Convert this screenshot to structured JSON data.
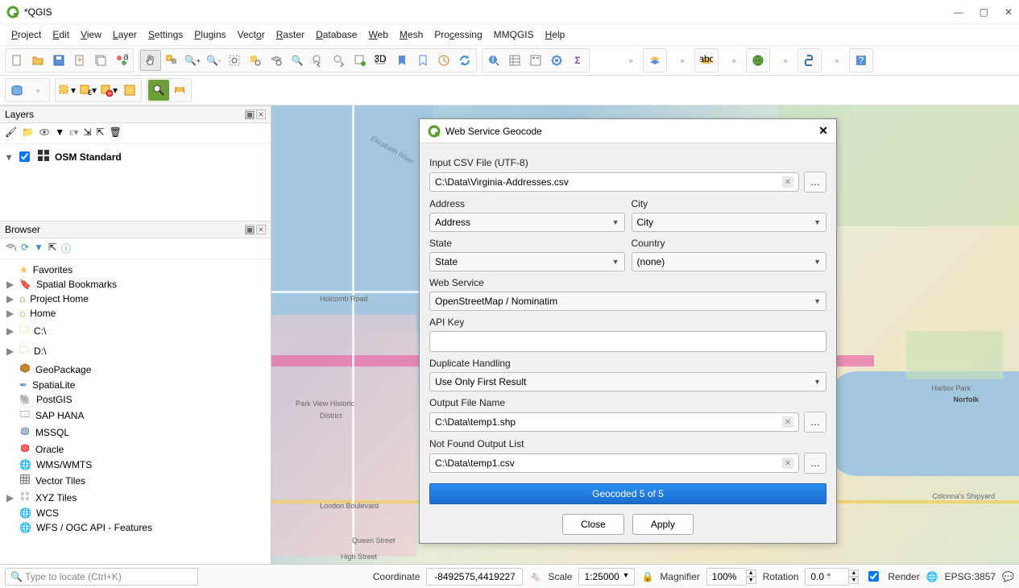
{
  "window": {
    "title": "*QGIS"
  },
  "menu": [
    "Project",
    "Edit",
    "View",
    "Layer",
    "Settings",
    "Plugins",
    "Vector",
    "Raster",
    "Database",
    "Web",
    "Mesh",
    "Processing",
    "MMQGIS",
    "Help"
  ],
  "panels": {
    "layers_title": "Layers",
    "browser_title": "Browser",
    "layer_name": "OSM Standard"
  },
  "browser_items": [
    {
      "icon": "star",
      "label": "Favorites",
      "exp": ""
    },
    {
      "icon": "bookmark",
      "label": "Spatial Bookmarks",
      "exp": "▶"
    },
    {
      "icon": "home-green",
      "label": "Project Home",
      "exp": "▶"
    },
    {
      "icon": "home",
      "label": "Home",
      "exp": "▶"
    },
    {
      "icon": "folder",
      "label": "C:\\",
      "exp": "▶"
    },
    {
      "icon": "folder",
      "label": "D:\\",
      "exp": "▶"
    },
    {
      "icon": "geopackage",
      "label": "GeoPackage",
      "exp": ""
    },
    {
      "icon": "spatialite",
      "label": "SpatiaLite",
      "exp": ""
    },
    {
      "icon": "postgis",
      "label": "PostGIS",
      "exp": ""
    },
    {
      "icon": "saphana",
      "label": "SAP HANA",
      "exp": ""
    },
    {
      "icon": "mssql",
      "label": "MSSQL",
      "exp": ""
    },
    {
      "icon": "oracle",
      "label": "Oracle",
      "exp": ""
    },
    {
      "icon": "wms",
      "label": "WMS/WMTS",
      "exp": ""
    },
    {
      "icon": "vectortiles",
      "label": "Vector Tiles",
      "exp": ""
    },
    {
      "icon": "xyz",
      "label": "XYZ Tiles",
      "exp": "▶"
    },
    {
      "icon": "wcs",
      "label": "WCS",
      "exp": ""
    },
    {
      "icon": "wfs",
      "label": "WFS / OGC API - Features",
      "exp": ""
    }
  ],
  "dialog": {
    "title": "Web Service Geocode",
    "labels": {
      "input_csv": "Input CSV File (UTF-8)",
      "address": "Address",
      "city": "City",
      "state": "State",
      "country": "Country",
      "web_service": "Web Service",
      "api_key": "API Key",
      "dup": "Duplicate Handling",
      "out_file": "Output File Name",
      "not_found": "Not Found Output List"
    },
    "values": {
      "input_csv": "C:\\Data\\Virginia-Addresses.csv",
      "address": "Address",
      "city": "City",
      "state": "State",
      "country": "(none)",
      "web_service": "OpenStreetMap / Nominatim",
      "api_key": "",
      "dup": "Use Only First Result",
      "out_file": "C:\\Data\\temp1.shp",
      "not_found": "C:\\Data\\temp1.csv"
    },
    "progress": "Geocoded 5 of 5",
    "close_btn": "Close",
    "apply_btn": "Apply"
  },
  "status": {
    "locator_placeholder": "Type to locate (Ctrl+K)",
    "coord_label": "Coordinate",
    "coord_value": "-8492575,4419227",
    "scale_label": "Scale",
    "scale_value": "1:25000",
    "magnifier_label": "Magnifier",
    "magnifier_value": "100%",
    "rotation_label": "Rotation",
    "rotation_value": "0.0 °",
    "render_label": "Render",
    "crs": "EPSG:3857"
  },
  "browse_dots": "…"
}
